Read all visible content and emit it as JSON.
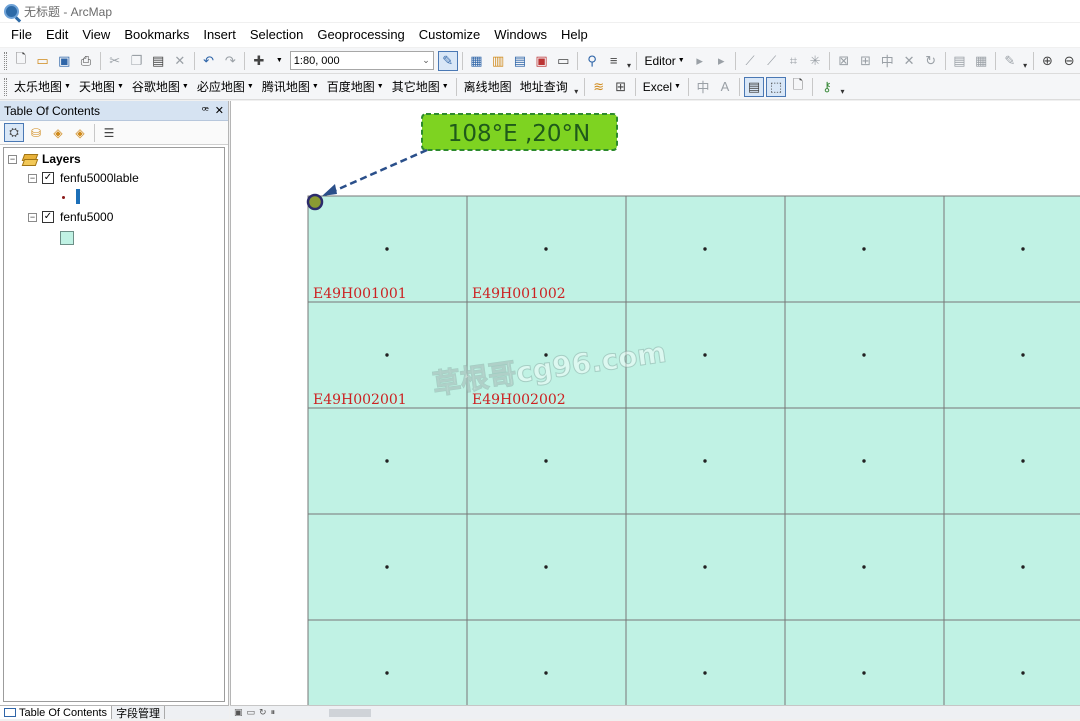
{
  "window": {
    "title": "无标题 - ArcMap"
  },
  "menu": [
    "File",
    "Edit",
    "View",
    "Bookmarks",
    "Insert",
    "Selection",
    "Geoprocessing",
    "Customize",
    "Windows",
    "Help"
  ],
  "standard_toolbar": {
    "scale": "1:80, 000",
    "editor_label": "Editor"
  },
  "basemap_toolbar": {
    "dropdowns": [
      "太乐地图",
      "天地图",
      "谷歌地图",
      "必应地图",
      "腾讯地图",
      "百度地图",
      "其它地图"
    ],
    "links": [
      "离线地图",
      "地址查询"
    ],
    "excel_label": "Excel"
  },
  "toc": {
    "title": "Table Of Contents",
    "root_label": "Layers",
    "layers": [
      {
        "name": "fenfu5000lable",
        "checked": true,
        "symbol": "point"
      },
      {
        "name": "fenfu5000",
        "checked": true,
        "symbol": "polygon"
      }
    ],
    "tabs": [
      "Table Of Contents",
      "字段管理"
    ]
  },
  "map": {
    "fill_color": "#c0f2e4",
    "line_color": "#777777",
    "label_color": "#cc2222",
    "cell_labels": [
      "E49H001001",
      "E49H001002",
      "E49H002001",
      "E49H002002"
    ],
    "callout_text": "108°E ,20°N",
    "callout_color": "#7ed321",
    "watermark": "草根哥cg96.com",
    "grid_rows": 5,
    "grid_cols": 5
  }
}
